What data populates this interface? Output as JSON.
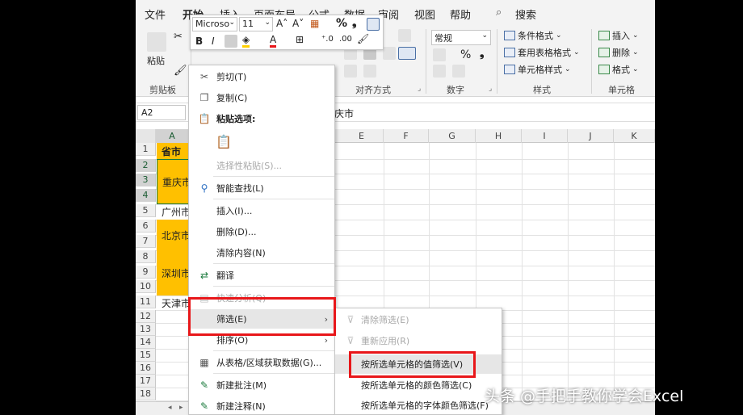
{
  "ribbon": {
    "tabs": [
      "文件",
      "开始",
      "插入",
      "页面布局",
      "公式",
      "数据",
      "审阅",
      "视图",
      "帮助"
    ],
    "search_label": "搜索",
    "groups": {
      "clipboard": "剪贴板",
      "alignment": "对齐方式",
      "number": "数字",
      "styles": "样式",
      "cells": "单元格"
    },
    "paste_label": "粘贴",
    "number_format": "常规",
    "styles_items": [
      "条件格式",
      "套用表格格式",
      "单元格样式"
    ],
    "cells_items": [
      "插入",
      "删除",
      "格式"
    ]
  },
  "mini_toolbar": {
    "font_name": "Microso",
    "font_size": "11",
    "bold": "B",
    "italic": "I",
    "percent": "%"
  },
  "formula_bar": {
    "name_box": "A2",
    "value": "庆市"
  },
  "grid": {
    "columns": [
      "A",
      "E",
      "F",
      "G",
      "H",
      "I",
      "J",
      "K"
    ],
    "rows": [
      "1",
      "2",
      "3",
      "4",
      "5",
      "6",
      "7",
      "8",
      "9",
      "10",
      "11",
      "12",
      "13",
      "14",
      "15",
      "16",
      "17",
      "18"
    ],
    "cells": {
      "a1": "省市",
      "chongqing": "重庆市",
      "guangzhou": "广州市",
      "beijing": "北京市",
      "shenzhen": "深圳市",
      "tianjin": "天津市"
    }
  },
  "context_menu": {
    "cut": "剪切(T)",
    "copy": "复制(C)",
    "paste_options": "粘贴选项:",
    "paste_special": "选择性粘贴(S)...",
    "smart_lookup": "智能查找(L)",
    "insert": "插入(I)...",
    "delete": "删除(D)...",
    "clear": "清除内容(N)",
    "translate": "翻译",
    "quick_analysis": "快速分析(Q)",
    "filter": "筛选(E)",
    "sort": "排序(O)",
    "get_data": "从表格/区域获取数据(G)...",
    "new_comment": "新建批注(M)",
    "new_note": "新建注释(N)"
  },
  "submenu": {
    "clear_filter": "清除筛选(E)",
    "reapply": "重新应用(R)",
    "by_value": "按所选单元格的值筛选(V)",
    "by_color": "按所选单元格的颜色筛选(C)",
    "by_font_color": "按所选单元格的字体颜色筛选(F)"
  },
  "watermark": "头条 @手把手教你学会Excel",
  "colors": {
    "highlight_yellow": "#ffc000",
    "annotation_red": "#e8171a",
    "excel_green": "#1a5c32"
  }
}
